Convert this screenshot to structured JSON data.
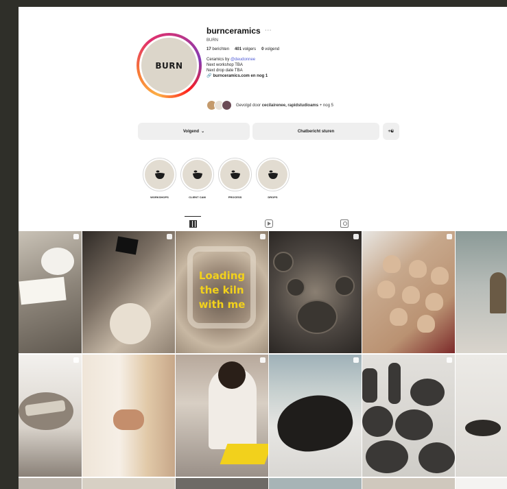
{
  "profile": {
    "username": "burnceramics",
    "display_name": "BURN",
    "avatar_text": "BURN",
    "stats": {
      "posts_count": "17",
      "posts_label": "berichten",
      "followers_count": "401",
      "followers_label": "volgers",
      "following_count": "0",
      "following_label": "volgend"
    },
    "bio": {
      "line1_prefix": "Ceramics by",
      "line1_mention": "@deudonnee",
      "line2": "Next workshop TBA",
      "line3": "Next drop date TBA",
      "link": "burnceramics.com en nog 1"
    },
    "followed_by": {
      "prefix": "Gevolgd door",
      "names": "cecilairenee, rapidstudioams",
      "suffix": "+ nog 5"
    }
  },
  "actions": {
    "follow_label": "Volgend",
    "message_label": "Chatbericht sturen"
  },
  "highlights": [
    {
      "label": "WORKSHOPS"
    },
    {
      "label": "CLIENT CAM"
    },
    {
      "label": "PROCESS"
    },
    {
      "label": "DROPS"
    }
  ],
  "posts": {
    "kiln_overlay_text": [
      "Loading",
      "the kiln",
      "with me"
    ]
  },
  "icons": {
    "more": "more-icon",
    "link": "link-icon",
    "chevron": "chevron-down-icon",
    "add_user": "add-user-icon",
    "grid_tab": "grid-icon",
    "reels_tab": "reels-icon",
    "tagged_tab": "tagged-icon"
  }
}
